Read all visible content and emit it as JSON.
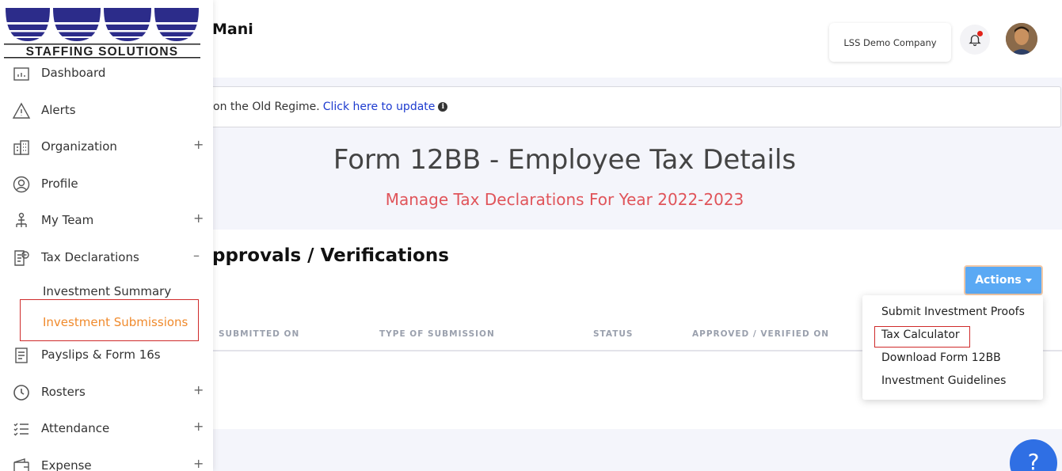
{
  "header": {
    "user_name": "Mani",
    "company": "LSS Demo Company"
  },
  "logo": {
    "text": "STAFFING SOLUTIONS",
    "color": "#2c2c8a"
  },
  "banner": {
    "text": "on the Old Regime.",
    "link": "Click here to update"
  },
  "page": {
    "title": "Form 12BB - Employee Tax Details",
    "subtitle": "Manage Tax Declarations For Year 2022-2023"
  },
  "main": {
    "section_title": "pprovals / Verifications",
    "actions_label": "Actions",
    "columns": [
      "SUBMITTED ON",
      "TYPE OF SUBMISSION",
      "STATUS",
      "APPROVED / VERIFIED ON"
    ]
  },
  "dropdown": {
    "items": [
      "Submit Investment Proofs",
      "Tax Calculator",
      "Download Form 12BB",
      "Investment Guidelines"
    ]
  },
  "sidebar": {
    "items": [
      {
        "label": "Dashboard",
        "toggle": ""
      },
      {
        "label": "Alerts",
        "toggle": ""
      },
      {
        "label": "Organization",
        "toggle": "+"
      },
      {
        "label": "Profile",
        "toggle": ""
      },
      {
        "label": "My Team",
        "toggle": "+"
      },
      {
        "label": "Tax Declarations",
        "toggle": "–"
      },
      {
        "label": "Payslips & Form 16s",
        "toggle": ""
      },
      {
        "label": "Rosters",
        "toggle": "+"
      },
      {
        "label": "Attendance",
        "toggle": "+"
      },
      {
        "label": "Expense",
        "toggle": "+"
      }
    ],
    "sub_items": [
      "Investment Summary",
      "Investment Submissions"
    ]
  },
  "help": {
    "label": "?"
  },
  "colors": {
    "accent_orange": "#f08a2c",
    "subtitle_red": "#e0545a",
    "actions_blue": "#5aa9f4",
    "link_blue": "#1d3bcf"
  }
}
